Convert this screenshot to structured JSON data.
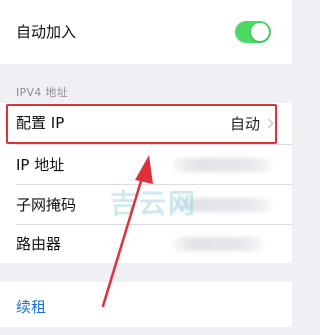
{
  "auto_join": {
    "label": "自动加入",
    "enabled": true
  },
  "ipv4_section": {
    "header": "IPV4 地址"
  },
  "configure_ip": {
    "label": "配置 IP",
    "value": "自动"
  },
  "ip_address": {
    "label": "IP 地址"
  },
  "subnet_mask": {
    "label": "子网掩码"
  },
  "router": {
    "label": "路由器"
  },
  "renew_lease": {
    "label": "续租"
  },
  "watermark": {
    "text": "吉云网"
  },
  "colors": {
    "toggle_on": "#4cd964",
    "highlight": "#e0303a",
    "link": "#1a73d9"
  }
}
